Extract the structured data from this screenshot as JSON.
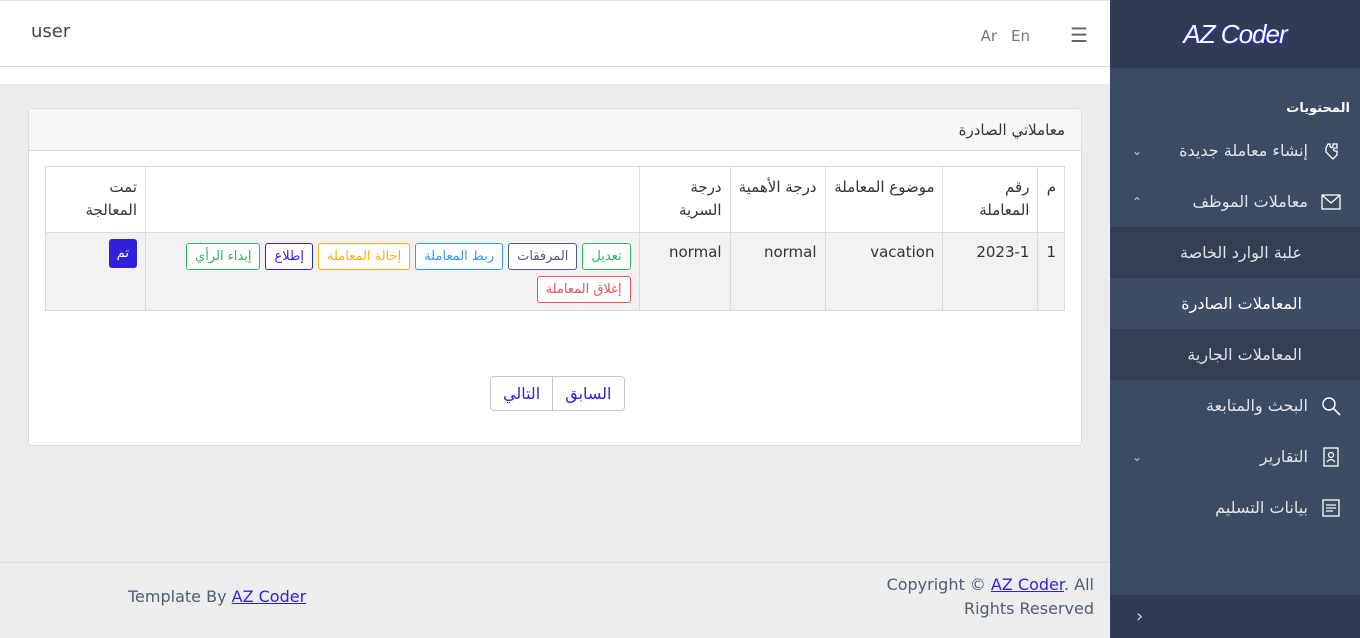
{
  "brand": "AZ Coder",
  "header": {
    "user": "user",
    "lang_ar": "Ar",
    "lang_en": "En"
  },
  "sidebar": {
    "section_title": "المحتويات",
    "items": [
      {
        "label": "إنشاء معاملة جديدة",
        "icon": "puzzle-icon",
        "chevron": "down"
      },
      {
        "label": "معاملات الموظف",
        "icon": "envelope-icon",
        "chevron": "up"
      },
      {
        "label": "البحث والمتابعة",
        "icon": "search-icon"
      },
      {
        "label": "التقارير",
        "icon": "address-book-icon",
        "chevron": "down"
      },
      {
        "label": "بيانات التسليم",
        "icon": "notes-icon"
      }
    ],
    "sub_items": [
      {
        "label": "علبة الوارد الخاصة",
        "active": false
      },
      {
        "label": "المعاملات الصادرة",
        "active": true
      },
      {
        "label": "المعاملات الجارية",
        "active": false
      }
    ]
  },
  "card": {
    "title": "معاملاتي الصادرة",
    "columns": [
      "م",
      "رقم المعاملة",
      "موضوع المعاملة",
      "درجة الأهمية",
      "درجة السرية",
      "",
      "تمت المعالجة"
    ],
    "rows": [
      {
        "index": "1",
        "number": "2023-1",
        "subject": "vacation",
        "importance": "normal",
        "confidentiality": "normal",
        "actions": [
          "تعديل",
          "المرفقات",
          "ربط المعاملة",
          "إحالة المعاملة",
          "إطلاع",
          "إبداء الرأي",
          "إغلاق المعاملة"
        ],
        "done_label": "تم"
      }
    ],
    "pager": {
      "prev": "السابق",
      "next": "التالي"
    }
  },
  "footer": {
    "template_prefix": "Template By",
    "template_link": "AZ Coder",
    "copyright_prefix": "Copyright ©",
    "copyright_link": "AZ Coder",
    "copyright_suffix": ". All Rights Reserved"
  },
  "colors": {
    "sidebar_bg": "#3c4b64",
    "primary": "#321fdb",
    "success": "#2eb85c",
    "info": "#3399ff",
    "warning": "#f9b115",
    "danger": "#e55353"
  }
}
